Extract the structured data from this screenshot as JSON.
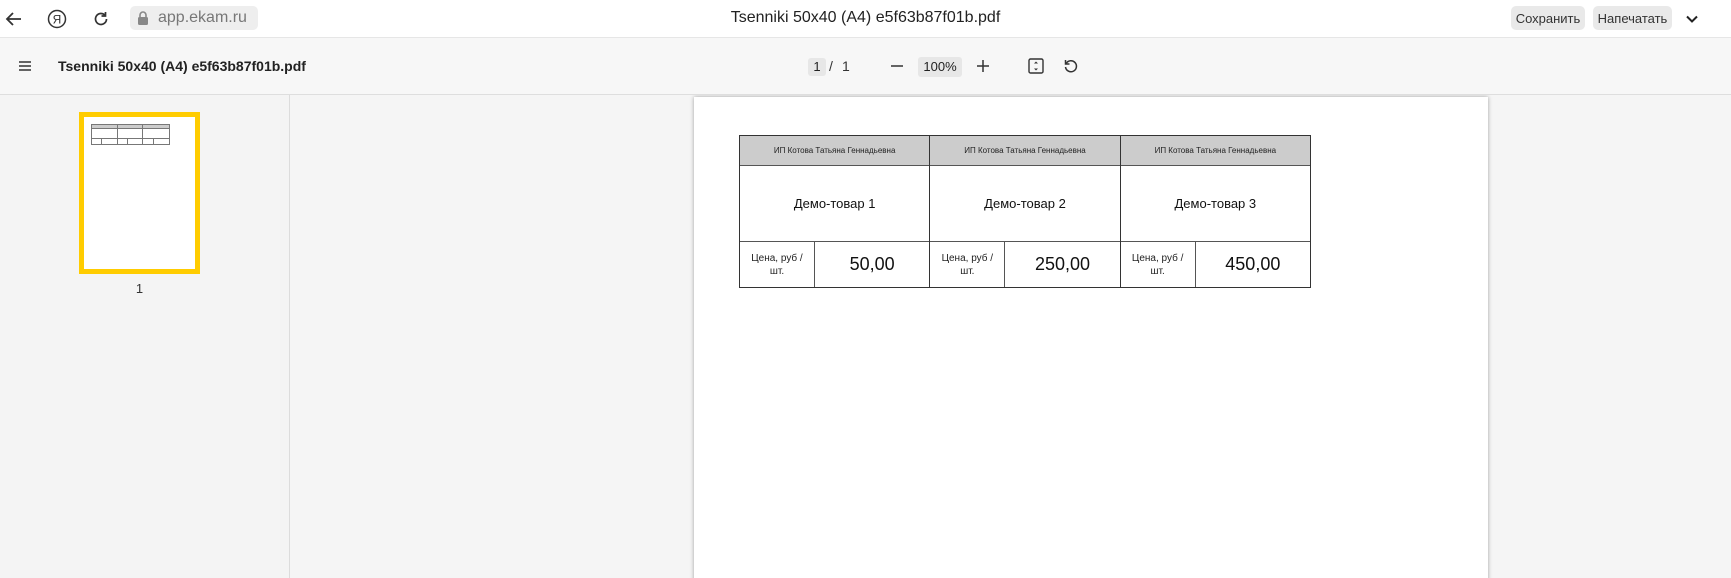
{
  "browser": {
    "url": "app.ekam.ru",
    "tab_title": "Tsenniki 50x40 (A4) e5f63b87f01b.pdf",
    "save_label": "Сохранить",
    "print_label": "Напечатать"
  },
  "toolbar": {
    "doc_title": "Tsenniki 50x40 (A4) e5f63b87f01b.pdf",
    "current_page": "1",
    "page_separator": "/",
    "total_pages": "1",
    "zoom": "100%"
  },
  "sidebar": {
    "thumbnails": [
      {
        "label": "1"
      }
    ]
  },
  "document": {
    "labels": [
      {
        "seller": "ИП Котова Татьяна Геннадьевна",
        "product": "Демо-товар 1",
        "unit": "Цена, руб / шт.",
        "price": "50,00"
      },
      {
        "seller": "ИП Котова Татьяна Геннадьевна",
        "product": "Демо-товар 2",
        "unit": "Цена, руб / шт.",
        "price": "250,00"
      },
      {
        "seller": "ИП Котова Татьяна Геннадьевна",
        "product": "Демо-товар 3",
        "unit": "Цена, руб / шт.",
        "price": "450,00"
      }
    ]
  },
  "colors": {
    "thumbnail_highlight": "#ffcc00",
    "label_header_bg": "#cccccc"
  }
}
